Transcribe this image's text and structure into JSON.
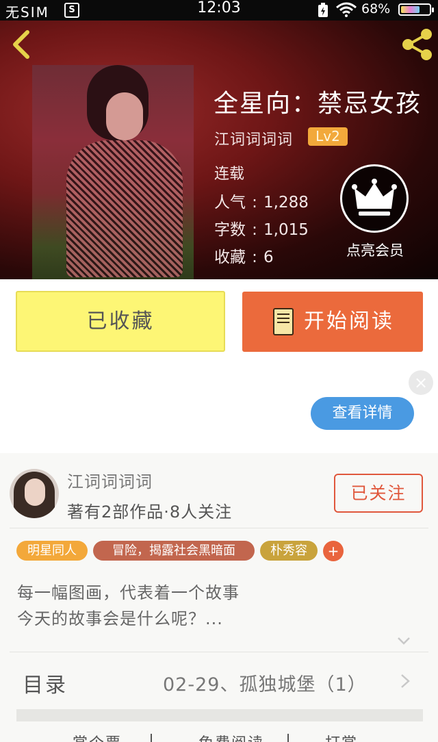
{
  "status_bar": {
    "sim": "无SIM",
    "sim_badge": "S",
    "time": "12:03",
    "battery_pct": "68%",
    "battery_level": 0.68
  },
  "header": {
    "title": "全星向：禁忌女孩",
    "author": "江词词词词",
    "level": "Lv2",
    "status": "连载",
    "stats": [
      {
        "label": "人气",
        "value": "1,288"
      },
      {
        "label": "字数",
        "value": "1,015"
      },
      {
        "label": "收藏",
        "value": "6"
      }
    ],
    "vip_label": "点亮会员"
  },
  "actions": {
    "collected_label": "已收藏",
    "read_label": "开始阅读"
  },
  "ad": {
    "close_glyph": "×",
    "detail_label": "查看详情"
  },
  "author_card": {
    "name": "江词词词词",
    "stats": "著有2部作品·8人关注",
    "follow_label": "已关注"
  },
  "tags": [
    {
      "label": "明星同人",
      "color": "#f3a83a"
    },
    {
      "label": "冒险，揭露社会黑暗面",
      "color": "#c2664e"
    },
    {
      "label": "朴秀容",
      "color": "#c9a33c"
    }
  ],
  "tag_plus": "+",
  "description": [
    "每一幅图画，代表着一个故事",
    "今天的故事会是什么呢？..."
  ],
  "toc": {
    "label": "目录",
    "latest": "02-29、孤独城堡（1）"
  },
  "bottom_nav": [
    "赏个票",
    "免费阅读",
    "打赏"
  ],
  "colors": {
    "accent_orange": "#eb6a3c",
    "collected_yellow": "#fdf675",
    "detail_blue": "#4a9ae2",
    "level_badge": "#f2a93b",
    "back_arrow": "#e6d24a",
    "share_icon": "#e6d24a"
  }
}
